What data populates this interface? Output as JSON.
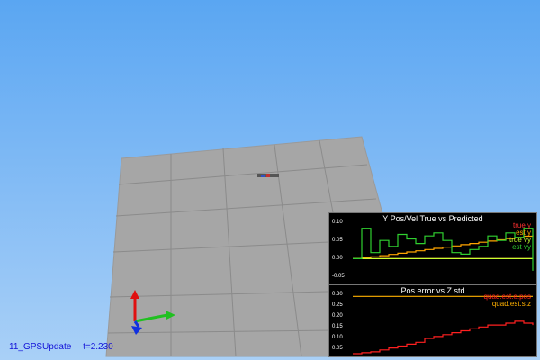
{
  "scene": {
    "sky_top": "#5aa6f2",
    "sky_bottom": "#a9d0f7",
    "ground_color": "#a6a6a6",
    "grid_color": "#8a8a8a",
    "axis_colors": {
      "x": "#20c020",
      "y": "#e01010",
      "z": "#1030e0"
    },
    "icons": [
      "quadcopter-icon",
      "axes-gizmo-icon"
    ]
  },
  "status": {
    "scenario": "11_GPSUpdate",
    "time": "t=2.230"
  },
  "chart_data": [
    {
      "type": "line",
      "title": "Y Pos/Vel True vs Predicted",
      "y_ticks": [
        "0.10",
        "0.05",
        "0.00",
        "-0.05"
      ],
      "ylim": [
        -0.07,
        0.12
      ],
      "x": [
        0,
        0.05,
        0.1,
        0.15,
        0.2,
        0.25,
        0.3,
        0.35,
        0.4,
        0.45,
        0.5,
        0.55,
        0.6,
        0.65,
        0.7,
        0.75,
        0.8,
        0.85,
        0.9,
        0.95,
        1.0
      ],
      "series": [
        {
          "name": "true y",
          "color": "#ff3030",
          "values": [
            0.0,
            0.0,
            0.0,
            0.0,
            0.0,
            0.0,
            0.0,
            0.0,
            0.0,
            0.0,
            0.0,
            0.0,
            0.0,
            0.0,
            0.0,
            0.0,
            0.0,
            0.0,
            0.0,
            0.0,
            0.0
          ]
        },
        {
          "name": "est y",
          "color": "#ffa500",
          "values": [
            0.0,
            0.003,
            0.006,
            0.01,
            0.014,
            0.018,
            0.022,
            0.026,
            0.03,
            0.034,
            0.038,
            0.042,
            0.046,
            0.05,
            0.054,
            0.058,
            0.062,
            0.066,
            0.07,
            0.074,
            0.078
          ]
        },
        {
          "name": "true vy",
          "color": "#c8ff30",
          "values": [
            0.0,
            0.0,
            0.0,
            0.0,
            0.0,
            0.0,
            0.0,
            0.0,
            0.0,
            0.0,
            0.0,
            0.0,
            0.0,
            0.0,
            0.0,
            0.0,
            0.0,
            0.0,
            0.0,
            0.0,
            0.0
          ]
        },
        {
          "name": "est vy",
          "color": "#30d030",
          "values": [
            0.0,
            0.1,
            0.02,
            0.06,
            0.04,
            0.08,
            0.065,
            0.05,
            0.075,
            0.085,
            0.06,
            0.02,
            0.015,
            0.03,
            0.04,
            0.075,
            0.06,
            0.085,
            0.07,
            0.1,
            -0.04
          ]
        }
      ]
    },
    {
      "type": "line",
      "title": "Pos error vs Z std",
      "y_ticks": [
        "0.30",
        "0.25",
        "0.20",
        "0.15",
        "0.10",
        "0.05"
      ],
      "ylim": [
        0.0,
        0.32
      ],
      "x": [
        0,
        0.05,
        0.1,
        0.15,
        0.2,
        0.25,
        0.3,
        0.35,
        0.4,
        0.45,
        0.5,
        0.55,
        0.6,
        0.65,
        0.7,
        0.75,
        0.8,
        0.85,
        0.9,
        0.95,
        1.0
      ],
      "series": [
        {
          "name": "quad.est.e.pos",
          "color": "#ff2020",
          "values": [
            0.0,
            0.005,
            0.01,
            0.02,
            0.03,
            0.04,
            0.05,
            0.06,
            0.08,
            0.09,
            0.1,
            0.11,
            0.12,
            0.13,
            0.14,
            0.15,
            0.15,
            0.16,
            0.17,
            0.16,
            0.15
          ]
        },
        {
          "name": "quad.est.s.z",
          "color": "#ffb000",
          "values": [
            0.3,
            0.3,
            0.3,
            0.3,
            0.3,
            0.3,
            0.3,
            0.3,
            0.3,
            0.3,
            0.3,
            0.3,
            0.3,
            0.3,
            0.3,
            0.3,
            0.3,
            0.3,
            0.3,
            0.3,
            0.3
          ]
        }
      ]
    }
  ]
}
